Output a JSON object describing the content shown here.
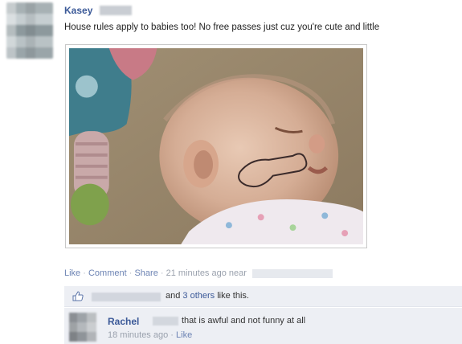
{
  "post": {
    "author": "Kasey",
    "status": "House rules apply to babies too! No free passes just cuz you're cute and little",
    "photo_icon": "photo-baby",
    "actions": {
      "like": "Like",
      "comment": "Comment",
      "share": "Share",
      "sep": "·",
      "time": "21 minutes ago near"
    }
  },
  "likes": {
    "icon": "thumbs-up-icon",
    "and_text": "and",
    "others_link": "3 others",
    "suffix": "like this."
  },
  "comment": {
    "author": "Rachel",
    "text": "that is awful and not funny at all",
    "time": "18 minutes ago",
    "sep": "·",
    "like": "Like"
  },
  "colors": {
    "link": "#3b5998",
    "meta_link": "#6d84b4",
    "panel": "#edeff4"
  }
}
